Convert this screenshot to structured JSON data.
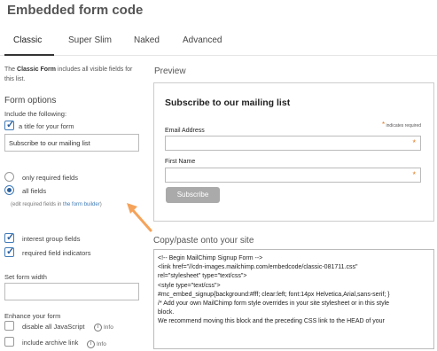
{
  "page": {
    "title": "Embedded form code"
  },
  "tabs": [
    {
      "label": "Classic",
      "active": true
    },
    {
      "label": "Super Slim",
      "active": false
    },
    {
      "label": "Naked",
      "active": false
    },
    {
      "label": "Advanced",
      "active": false
    }
  ],
  "intro": {
    "prefix": "The ",
    "bold": "Classic Form",
    "suffix": " includes all visible fields for this list."
  },
  "form_options": {
    "title": "Form options",
    "include_label": "Include the following:",
    "title_checkbox_label": "a title for your form",
    "title_checked": true,
    "title_value": "Subscribe to our mailing list",
    "only_required_label": "only required fields",
    "all_fields_label": "all fields",
    "fields_choice": "all fields",
    "edit_note_prefix": "(edit required fields in ",
    "edit_note_link": "the form builder",
    "edit_note_suffix": ")",
    "interest_groups_label": "interest group fields",
    "interest_groups_checked": true,
    "required_indicators_label": "required field indicators",
    "required_indicators_checked": true,
    "width_label": "Set form width",
    "width_value": ""
  },
  "enhance": {
    "title": "Enhance your form",
    "javascript_label": "disable all JavaScript",
    "javascript_checked": false,
    "archive_label": "include archive link",
    "archive_checked": false,
    "info_label": "Info",
    "info_glyph": "i"
  },
  "preview": {
    "title": "Preview",
    "heading": "Subscribe to our mailing list",
    "required_star": "*",
    "required_text": "indicates required",
    "email_label": "Email Address",
    "first_name_label": "First Name",
    "star": "*",
    "button_label": "Subscribe"
  },
  "copy": {
    "title": "Copy/paste onto your site",
    "code_lines": [
      "<!-- Begin MailChimp Signup Form -->",
      "<link href=\"//cdn-images.mailchimp.com/embedcode/classic-081711.css\"",
      "rel=\"stylesheet\" type=\"text/css\">",
      "<style type=\"text/css\">",
      "        #mc_embed_signup{background:#fff; clear:left; font:14px Helvetica,Arial,sans-serif; }",
      "        /* Add your own MailChimp form style overrides in your site stylesheet or in this style",
      "block.",
      "           We recommend moving this block and the preceding CSS link to the HEAD of your"
    ]
  },
  "colors": {
    "accent_blue": "#3f7bb7",
    "required_orange": "#e07a1f",
    "arrow_orange": "#f5a35a",
    "button_gray": "#aaaaaa"
  }
}
